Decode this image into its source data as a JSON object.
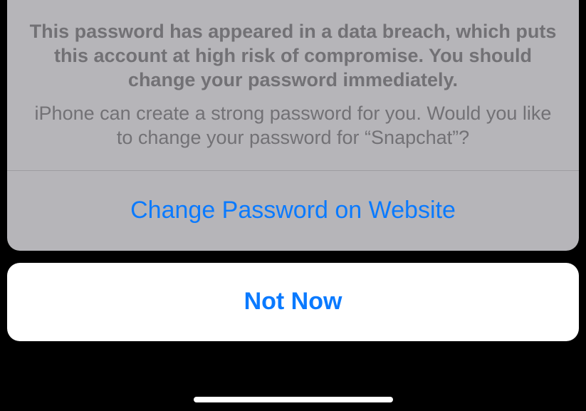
{
  "alert": {
    "title": "This password has appeared in a data breach, which puts this account at high risk of compromise. You should change your password immediately.",
    "subtitle": "iPhone can create a strong password for you. Would you like to change your password for “Snapchat”?",
    "primary_action": "Change Password on Website",
    "cancel_action": "Not Now"
  }
}
